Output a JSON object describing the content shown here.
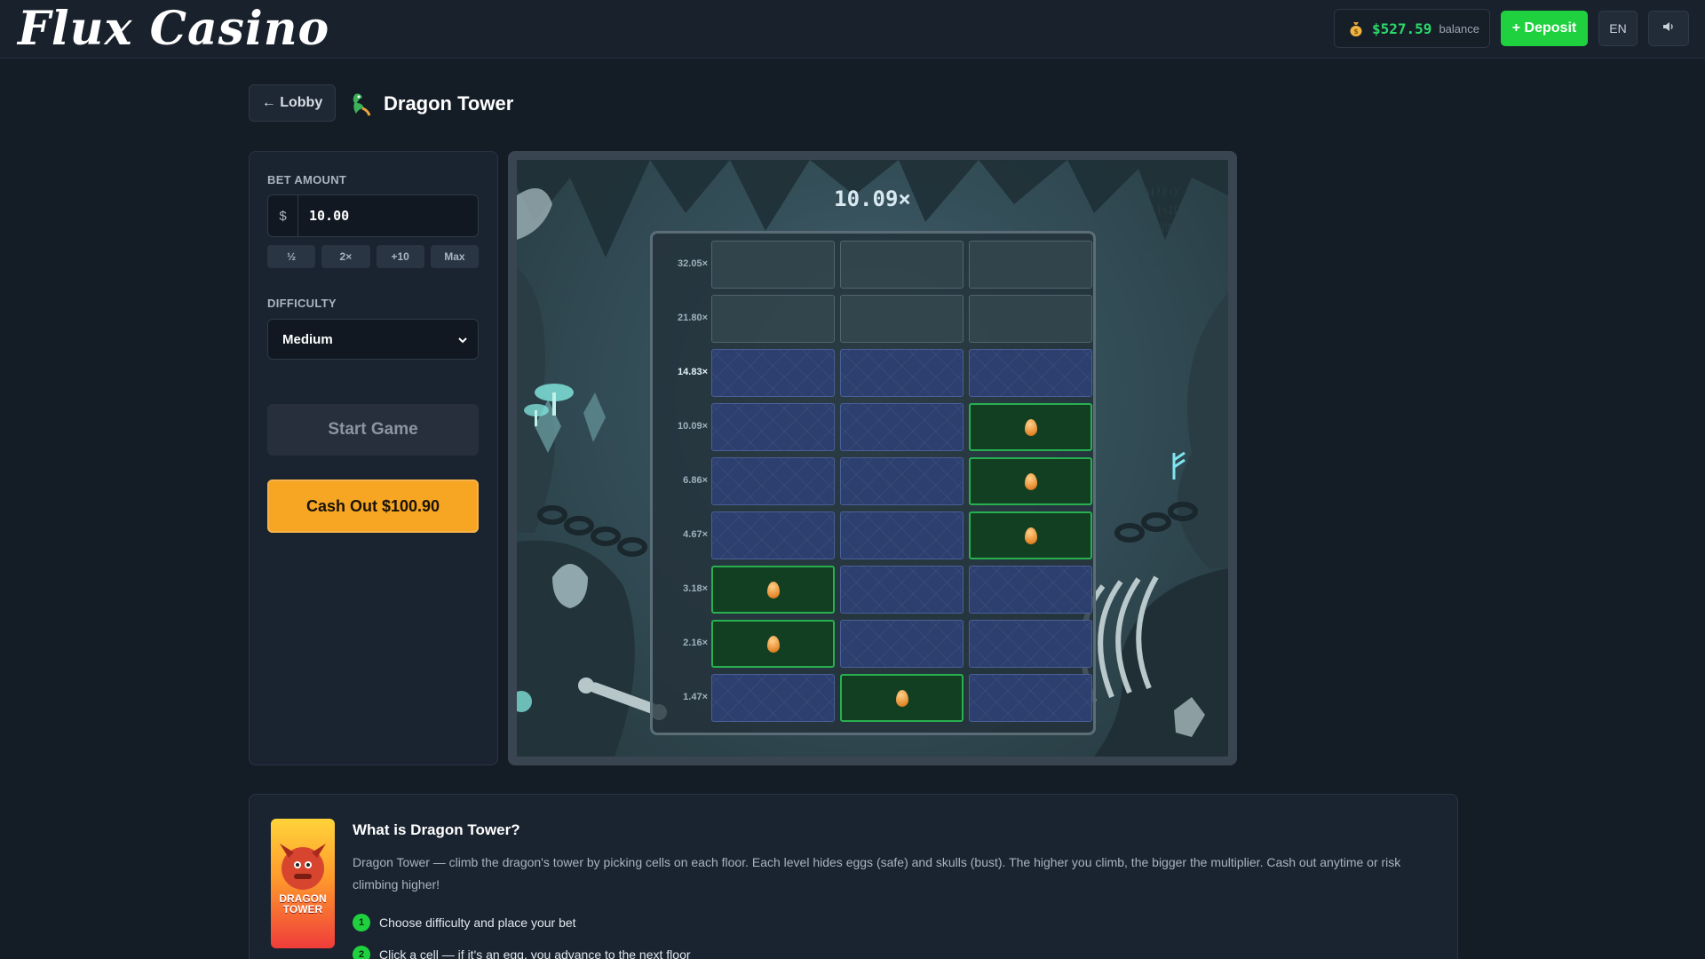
{
  "brand": {
    "logo": "Flux Casino"
  },
  "header": {
    "balance_amount": "$527.59",
    "balance_label": "balance",
    "deposit_label": "+ Deposit",
    "language": "EN",
    "icons": {
      "balance": "money-bag-icon",
      "sound": "speaker-icon"
    }
  },
  "nav": {
    "lobby_label": "← Lobby",
    "game_title": "Dragon Tower",
    "game_icon": "dragon-icon"
  },
  "controls": {
    "bet_label": "BET AMOUNT",
    "currency": "$",
    "bet_value": "10.00",
    "quick_buttons": [
      "½",
      "2×",
      "+10",
      "Max"
    ],
    "difficulty_label": "DIFFICULTY",
    "difficulty_value": "Medium",
    "start_label": "Start Game",
    "cashout_label": "Cash Out $100.90"
  },
  "game": {
    "current_multiplier": "10.09×",
    "rows": [
      {
        "multiplier": "32.05×",
        "cells": [
          "locked",
          "locked",
          "locked"
        ]
      },
      {
        "multiplier": "21.80×",
        "cells": [
          "locked",
          "locked",
          "locked"
        ]
      },
      {
        "multiplier": "14.83×",
        "cells": [
          "open",
          "open",
          "open"
        ],
        "active": true
      },
      {
        "multiplier": "10.09×",
        "cells": [
          "open",
          "open",
          "egg"
        ]
      },
      {
        "multiplier": "6.86×",
        "cells": [
          "open",
          "open",
          "egg"
        ]
      },
      {
        "multiplier": "4.67×",
        "cells": [
          "open",
          "open",
          "egg"
        ]
      },
      {
        "multiplier": "3.18×",
        "cells": [
          "egg",
          "open",
          "open"
        ]
      },
      {
        "multiplier": "2.16×",
        "cells": [
          "egg",
          "open",
          "open"
        ]
      },
      {
        "multiplier": "1.47×",
        "cells": [
          "open",
          "egg",
          "open"
        ]
      }
    ]
  },
  "info": {
    "title": "What is Dragon Tower?",
    "thumb_text_1": "DRAGON",
    "thumb_text_2": "TOWER",
    "description": "Dragon Tower — climb the dragon's tower by picking cells on each floor. Each level hides eggs (safe) and skulls (bust). The higher you climb, the bigger the multiplier. Cash out anytime or risk climbing higher!",
    "steps": [
      "Choose difficulty and place your bet",
      "Click a cell — if it's an egg, you advance to the next floor"
    ]
  },
  "colors": {
    "accent_green": "#1fd13f",
    "cashout_orange": "#f6a623",
    "balance_green": "#2bd96a"
  }
}
